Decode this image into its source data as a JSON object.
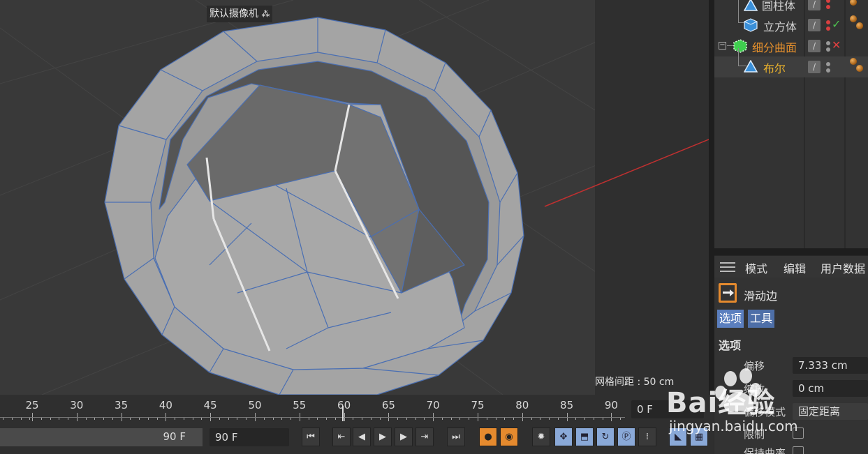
{
  "viewport": {
    "camera_label": "默认摄像机",
    "camera_icon": "camera-icon",
    "grid_spacing": "网格间距 : 50 cm"
  },
  "object_manager": {
    "items": [
      {
        "name": "圆柱体",
        "icon": "cylinder-icon",
        "color": "#d4d4d4"
      },
      {
        "name": "立方体",
        "icon": "cube-icon",
        "color": "#d4d4d4"
      },
      {
        "name": "细分曲面",
        "icon": "subdivision-surface-icon",
        "color": "#e8912c"
      },
      {
        "name": "布尔",
        "icon": "boole-icon",
        "color": "#e8b02c"
      }
    ]
  },
  "attributes": {
    "menu": [
      "模式",
      "编辑",
      "用户数据"
    ],
    "tool_name": "滑动边",
    "tabs": [
      "选项",
      "工具"
    ],
    "section": "选项",
    "fields": {
      "offset_label": "偏移",
      "offset_value": "7.333 cm",
      "scale_label": "缩放",
      "scale_value": "0 cm",
      "mode_label": "偏移模式",
      "mode_value": "固定距离",
      "limit_label": "限制",
      "keep_curve_label": "保持曲率"
    }
  },
  "timeline": {
    "ticks": [
      "25",
      "30",
      "35",
      "40",
      "45",
      "50",
      "55",
      "60",
      "65",
      "70",
      "75",
      "80",
      "85",
      "90"
    ],
    "current_frame": "0 F",
    "end_frame_a": "90 F",
    "end_frame_b": "90 F"
  },
  "watermark": {
    "brand": "Bai经验",
    "url": "jingyan.baidu.com"
  },
  "colors": {
    "viewport_bg": "#393939",
    "mesh_face": "#a3a3a3",
    "mesh_edge": "#4a6fb3",
    "axis_red": "#c03030",
    "accent_orange": "#e58a2e",
    "accent_blue": "#8aa9d8"
  }
}
